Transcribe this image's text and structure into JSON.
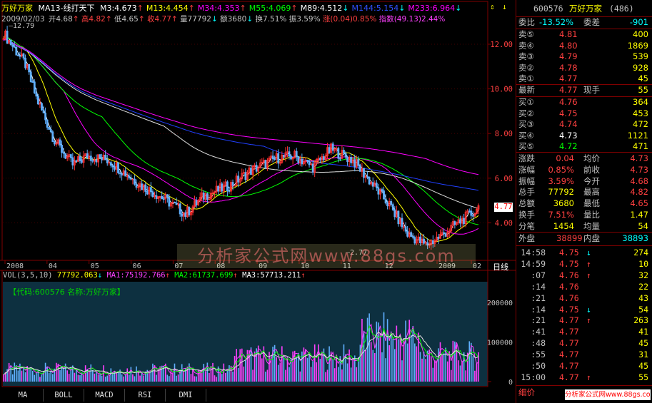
{
  "header": {
    "stock_name": "万好万家",
    "indicator": "MA13-线打天下",
    "ma_values": [
      {
        "label": "M3:4.673",
        "arrow": "↑",
        "color": "#ffffff"
      },
      {
        "label": "M13:4.454",
        "arrow": "↑",
        "color": "#ffff00"
      },
      {
        "label": "M34:4.353",
        "arrow": "↑",
        "color": "#ff00ff"
      },
      {
        "label": "M55:4.069",
        "arrow": "↑",
        "color": "#00ff00"
      },
      {
        "label": "M89:4.512",
        "arrow": "↓",
        "color": "#ffffff"
      },
      {
        "label": "M144:5.154",
        "arrow": "↓",
        "color": "#3050ff"
      },
      {
        "label": "M233:6.964",
        "arrow": "↓",
        "color": "#ff00ff"
      }
    ],
    "date": "2009/02/03",
    "open": "开4.68",
    "open_arrow": "↑",
    "high": "高4.82",
    "high_arrow": "↑",
    "low": "低4.65",
    "low_arrow": "↑",
    "close": "收4.77",
    "close_arrow": "↑",
    "volume": "量77792",
    "volume_arrow": "↓",
    "amount": "额3680",
    "amount_arrow": "↓",
    "turnover": "换7.51%",
    "amplitude": "振3.59%",
    "change": "涨(0.04)0.85%",
    "index": "指数(49.13)2.44%"
  },
  "chart": {
    "y_ticks": [
      "12.00",
      "10.00",
      "8.00",
      "6.00",
      "4.00"
    ],
    "price_label": "4.77",
    "high_mark": "12.79",
    "low_mark": "2.77",
    "x_labels": [
      "2008",
      "04",
      "05",
      "06",
      "07",
      "08",
      "09",
      "10",
      "11",
      "12",
      "2009",
      "02"
    ],
    "period": "日线",
    "watermark": "分析家公式网www.88gs.com"
  },
  "volume_panel": {
    "title": "VOL(3,5,10)",
    "vol": "77792.063",
    "vol_arrow": "↓",
    "ma1": "MA1:75192.766",
    "ma1_arrow": "↑",
    "ma2": "MA2:61737.699",
    "ma2_arrow": "↑",
    "ma3": "MA3:57713.211",
    "ma3_arrow": "↑",
    "info": "【代码:600576 名称:万好万家】",
    "y_ticks": [
      "200000",
      "100000",
      "0"
    ]
  },
  "tabs": [
    "MA",
    "BOLL",
    "MACD",
    "RSI",
    "DMI"
  ],
  "quote": {
    "code": "600576",
    "name": "万好万家",
    "num": "(486)",
    "weibi_label": "委比",
    "weibi": "-13.52%",
    "weicha_label": "委差",
    "weicha": "-901",
    "sells": [
      {
        "label": "卖⑤",
        "price": "4.81",
        "vol": "400"
      },
      {
        "label": "卖④",
        "price": "4.80",
        "vol": "1869"
      },
      {
        "label": "卖③",
        "price": "4.79",
        "vol": "539"
      },
      {
        "label": "卖②",
        "price": "4.78",
        "vol": "928"
      },
      {
        "label": "卖①",
        "price": "4.77",
        "vol": "45"
      }
    ],
    "latest_label": "最新",
    "latest": "4.77",
    "xianshou_label": "现手",
    "xianshou": "55",
    "buys": [
      {
        "label": "买①",
        "price": "4.76",
        "vol": "364"
      },
      {
        "label": "买②",
        "price": "4.75",
        "vol": "453"
      },
      {
        "label": "买③",
        "price": "4.74",
        "vol": "472"
      },
      {
        "label": "买④",
        "price": "4.73",
        "vol": "1121"
      },
      {
        "label": "买⑤",
        "price": "4.72",
        "vol": "471"
      }
    ],
    "stats": [
      {
        "l1": "涨跌",
        "v1": "0.04",
        "l2": "均价",
        "v2": "4.73"
      },
      {
        "l1": "涨幅",
        "v1": "0.85%",
        "l2": "前收",
        "v2": "4.73"
      },
      {
        "l1": "振幅",
        "v1": "3.59%",
        "l2": "今开",
        "v2": "4.68"
      },
      {
        "l1": "总手",
        "v1": "77792",
        "l2": "最高",
        "v2": "4.82"
      },
      {
        "l1": "总额",
        "v1": "3680",
        "l2": "最低",
        "v2": "4.65"
      },
      {
        "l1": "换手",
        "v1": "7.51%",
        "l2": "量比",
        "v2": "1.47"
      },
      {
        "l1": "分笔",
        "v1": "1454",
        "l2": "均量",
        "v2": "54"
      }
    ],
    "waipan_label": "外盘",
    "waipan": "38899",
    "neipan_label": "内盘",
    "neipan": "38893",
    "ticks": [
      {
        "time": "14:58",
        "price": "4.75",
        "arrow": "↓",
        "vol": "274"
      },
      {
        "time": "14:59",
        "price": "4.75",
        "arrow": "↑",
        "vol": "10"
      },
      {
        "time": ":07",
        "price": "4.76",
        "arrow": "↑",
        "vol": "32"
      },
      {
        "time": ":14",
        "price": "4.76",
        "arrow": "",
        "vol": "22"
      },
      {
        "time": ":21",
        "price": "4.76",
        "arrow": "",
        "vol": "43"
      },
      {
        "time": ":14",
        "price": "4.75",
        "arrow": "↓",
        "vol": "54"
      },
      {
        "time": ":21",
        "price": "4.77",
        "arrow": "↑",
        "vol": "263"
      },
      {
        "time": ":41",
        "price": "4.77",
        "arrow": "",
        "vol": "41"
      },
      {
        "time": ":48",
        "price": "4.77",
        "arrow": "",
        "vol": "45"
      },
      {
        "time": ":55",
        "price": "4.77",
        "arrow": "",
        "vol": "31"
      },
      {
        "time": ":50",
        "price": "4.77",
        "arrow": "",
        "vol": "45"
      },
      {
        "time": "15:00",
        "price": "4.77",
        "arrow": "↑",
        "vol": "55"
      }
    ],
    "detail_label": "细价",
    "footer_ad": "分析家公式网www.88gs.com"
  }
}
